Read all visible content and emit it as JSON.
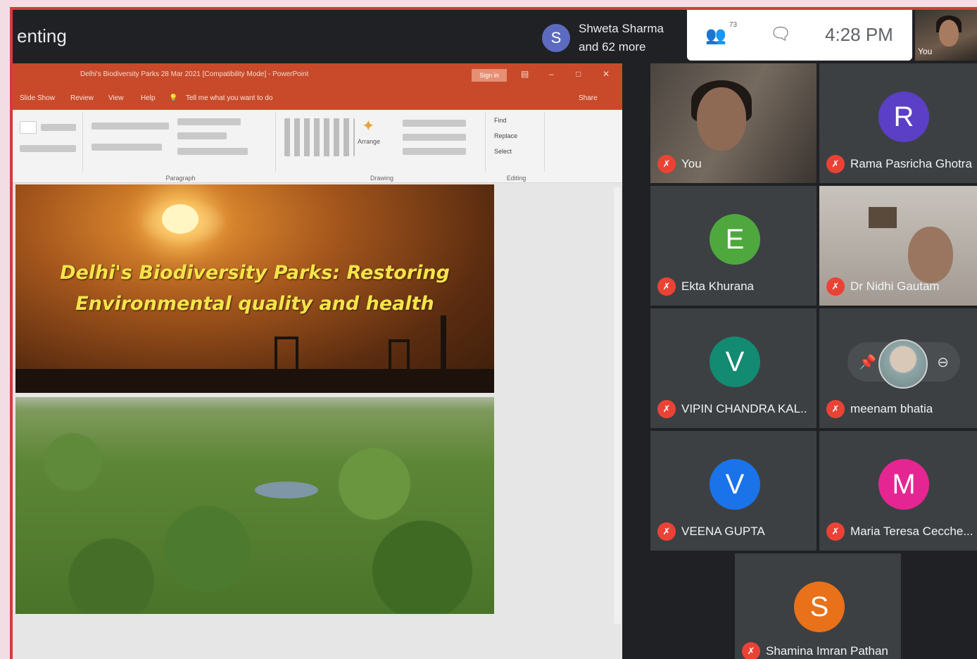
{
  "meet": {
    "presenting_label": "enting",
    "presenter_avatar": "S",
    "presenter_line1": "Shweta Sharma",
    "presenter_line2": "and 62 more",
    "people_count": "73",
    "clock": "4:28 PM",
    "self_label": "You",
    "accent": "#d33c3c"
  },
  "ppt": {
    "window_title": "Delhi's Biodiversity Parks 28 Mar 2021 [Compatibility Mode] - PowerPoint",
    "sign_in": "Sign in",
    "menu": [
      "Slide Show",
      "Review",
      "View",
      "Help",
      "Tell me what you want to do"
    ],
    "share": "Share",
    "ribbon_groups": [
      "Paragraph",
      "Drawing",
      "Editing"
    ],
    "ribbon_editing": [
      "Find",
      "Replace",
      "Select"
    ],
    "arrange_label": "Arrange",
    "brand_color": "#c84a2a"
  },
  "slide": {
    "title_line1": "Delhi's Biodiversity Parks: Restoring",
    "title_line2": "Environmental quality and health"
  },
  "participants": [
    {
      "name": "You",
      "type": "video"
    },
    {
      "name": "Rama Pasricha Ghotra",
      "avatar": "R",
      "color": "#5b3fc6",
      "type": "avatar"
    },
    {
      "name": "Ekta Khurana",
      "avatar": "E",
      "color": "#4fa83d",
      "type": "avatar"
    },
    {
      "name": "Dr Nidhi Gautam",
      "type": "video"
    },
    {
      "name": "VIPIN CHANDRA KAL...",
      "avatar": "V",
      "color": "#138a72",
      "type": "avatar"
    },
    {
      "name": "meenam bhatia",
      "type": "picture"
    },
    {
      "name": "VEENA GUPTA",
      "avatar": "V",
      "color": "#1a73e8",
      "type": "avatar"
    },
    {
      "name": "Maria Teresa Cecche...",
      "avatar": "M",
      "color": "#e52592",
      "type": "avatar"
    },
    {
      "name": "Shamina Imran Pathan",
      "avatar": "S",
      "color": "#e8711a",
      "type": "avatar"
    }
  ]
}
